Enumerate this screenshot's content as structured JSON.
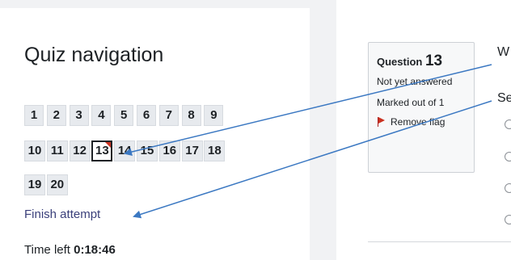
{
  "quiz_nav": {
    "title": "Quiz navigation",
    "questions": [
      "1",
      "2",
      "3",
      "4",
      "5",
      "6",
      "7",
      "8",
      "9",
      "10",
      "11",
      "12",
      "13",
      "14",
      "15",
      "16",
      "17",
      "18",
      "19",
      "20"
    ],
    "current": "13",
    "flagged": "13",
    "finish_label": "Finish attempt",
    "time_left_label": "Time left",
    "time_left_value": "0:18:46"
  },
  "question_info": {
    "question_word": "Question",
    "number": "13",
    "state": "Not yet answered",
    "grade": "Marked out of 1",
    "flag_label": "Remove flag"
  },
  "question_text_partial": "W",
  "select_partial": "Se",
  "colors": {
    "arrow": "#3b78c2",
    "link": "#3a3f7a",
    "flag": "#ca3120",
    "button_bg": "#e7eaee"
  }
}
